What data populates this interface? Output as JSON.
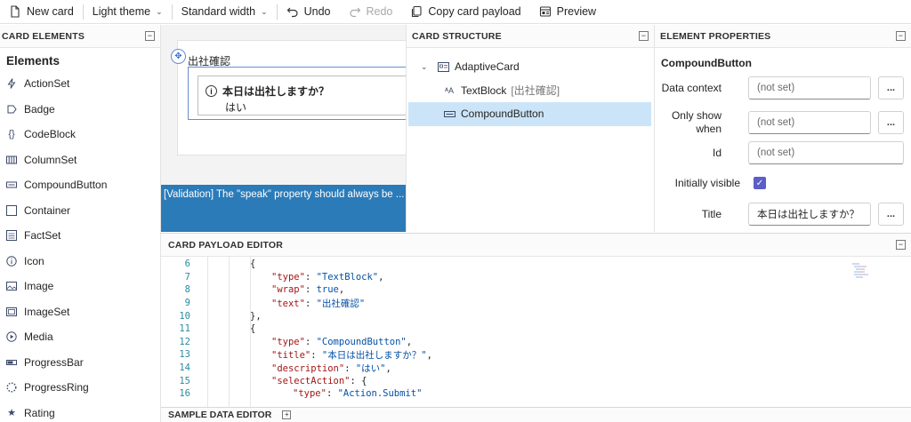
{
  "toolbar": {
    "new_card": "New card",
    "theme": "Light theme",
    "width": "Standard width",
    "undo": "Undo",
    "redo": "Redo",
    "copy_payload": "Copy card payload",
    "preview": "Preview"
  },
  "card_elements": {
    "header": "CARD ELEMENTS",
    "title": "Elements",
    "items": [
      {
        "label": "ActionSet",
        "icon": "lightning-icon"
      },
      {
        "label": "Badge",
        "icon": "badge-icon"
      },
      {
        "label": "CodeBlock",
        "icon": "code-braces-icon"
      },
      {
        "label": "ColumnSet",
        "icon": "columns-icon"
      },
      {
        "label": "CompoundButton",
        "icon": "compound-button-icon"
      },
      {
        "label": "Container",
        "icon": "container-icon"
      },
      {
        "label": "FactSet",
        "icon": "factset-icon"
      },
      {
        "label": "Icon",
        "icon": "info-circle-icon"
      },
      {
        "label": "Image",
        "icon": "image-icon"
      },
      {
        "label": "ImageSet",
        "icon": "imageset-icon"
      },
      {
        "label": "Media",
        "icon": "media-play-icon"
      },
      {
        "label": "ProgressBar",
        "icon": "progress-bar-icon"
      },
      {
        "label": "ProgressRing",
        "icon": "progress-ring-icon"
      },
      {
        "label": "Rating",
        "icon": "star-icon"
      }
    ]
  },
  "canvas": {
    "text_block": "出社確認",
    "compound_title": "本日は出社しますか？",
    "compound_description": "はい",
    "validation": "[Validation] The \"speak\" property should always be ..."
  },
  "card_structure": {
    "header": "CARD STRUCTURE",
    "root": "AdaptiveCard",
    "text_block": "TextBlock",
    "text_block_sub": "[出社確認]",
    "compound_button": "CompoundButton"
  },
  "element_properties": {
    "header": "ELEMENT PROPERTIES",
    "title": "CompoundButton",
    "data_context_label": "Data context",
    "data_context_value": "(not set)",
    "only_show_when_label": "Only show when",
    "only_show_when_value": "(not set)",
    "id_label": "Id",
    "id_value": "(not set)",
    "initially_visible_label": "Initially visible",
    "initially_visible": true,
    "title_label": "Title",
    "title_value": "本日は出社しますか？",
    "dots": "..."
  },
  "payload_editor": {
    "header": "CARD PAYLOAD EDITOR",
    "lines": [
      {
        "n": "6",
        "indent": 0,
        "tokens": [
          [
            "p",
            "{"
          ]
        ]
      },
      {
        "n": "7",
        "indent": 1,
        "tokens": [
          [
            "k",
            "\"type\""
          ],
          [
            "p",
            ": "
          ],
          [
            "s",
            "\"TextBlock\""
          ],
          [
            "p",
            ","
          ]
        ]
      },
      {
        "n": "8",
        "indent": 1,
        "tokens": [
          [
            "k",
            "\"wrap\""
          ],
          [
            "p",
            ": "
          ],
          [
            "s",
            "true"
          ],
          [
            "p",
            ","
          ]
        ]
      },
      {
        "n": "9",
        "indent": 1,
        "tokens": [
          [
            "k",
            "\"text\""
          ],
          [
            "p",
            ": "
          ],
          [
            "s",
            "\"出社確認\""
          ]
        ]
      },
      {
        "n": "10",
        "indent": 0,
        "tokens": [
          [
            "p",
            "},"
          ]
        ]
      },
      {
        "n": "11",
        "indent": 0,
        "tokens": [
          [
            "p",
            "{"
          ]
        ]
      },
      {
        "n": "12",
        "indent": 1,
        "tokens": [
          [
            "k",
            "\"type\""
          ],
          [
            "p",
            ": "
          ],
          [
            "s",
            "\"CompoundButton\""
          ],
          [
            "p",
            ","
          ]
        ]
      },
      {
        "n": "13",
        "indent": 1,
        "tokens": [
          [
            "k",
            "\"title\""
          ],
          [
            "p",
            ": "
          ],
          [
            "s",
            "\"本日は出社しますか？\""
          ],
          [
            "p",
            ","
          ]
        ]
      },
      {
        "n": "14",
        "indent": 1,
        "tokens": [
          [
            "k",
            "\"description\""
          ],
          [
            "p",
            ": "
          ],
          [
            "s",
            "\"はい\""
          ],
          [
            "p",
            ","
          ]
        ]
      },
      {
        "n": "15",
        "indent": 1,
        "tokens": [
          [
            "k",
            "\"selectAction\""
          ],
          [
            "p",
            ": {"
          ]
        ]
      },
      {
        "n": "16",
        "indent": 2,
        "tokens": [
          [
            "k",
            "\"type\""
          ],
          [
            "p",
            ": "
          ],
          [
            "s",
            "\"Action.Submit\""
          ]
        ]
      }
    ]
  },
  "sample_data_editor": {
    "header": "SAMPLE DATA EDITOR"
  },
  "colors": {
    "validation_bg": "#2b7bb9",
    "selection_bg": "#cce4f7",
    "checkbox": "#5b5fc7",
    "json_key": "#a31515",
    "json_value": "#0451a5"
  }
}
